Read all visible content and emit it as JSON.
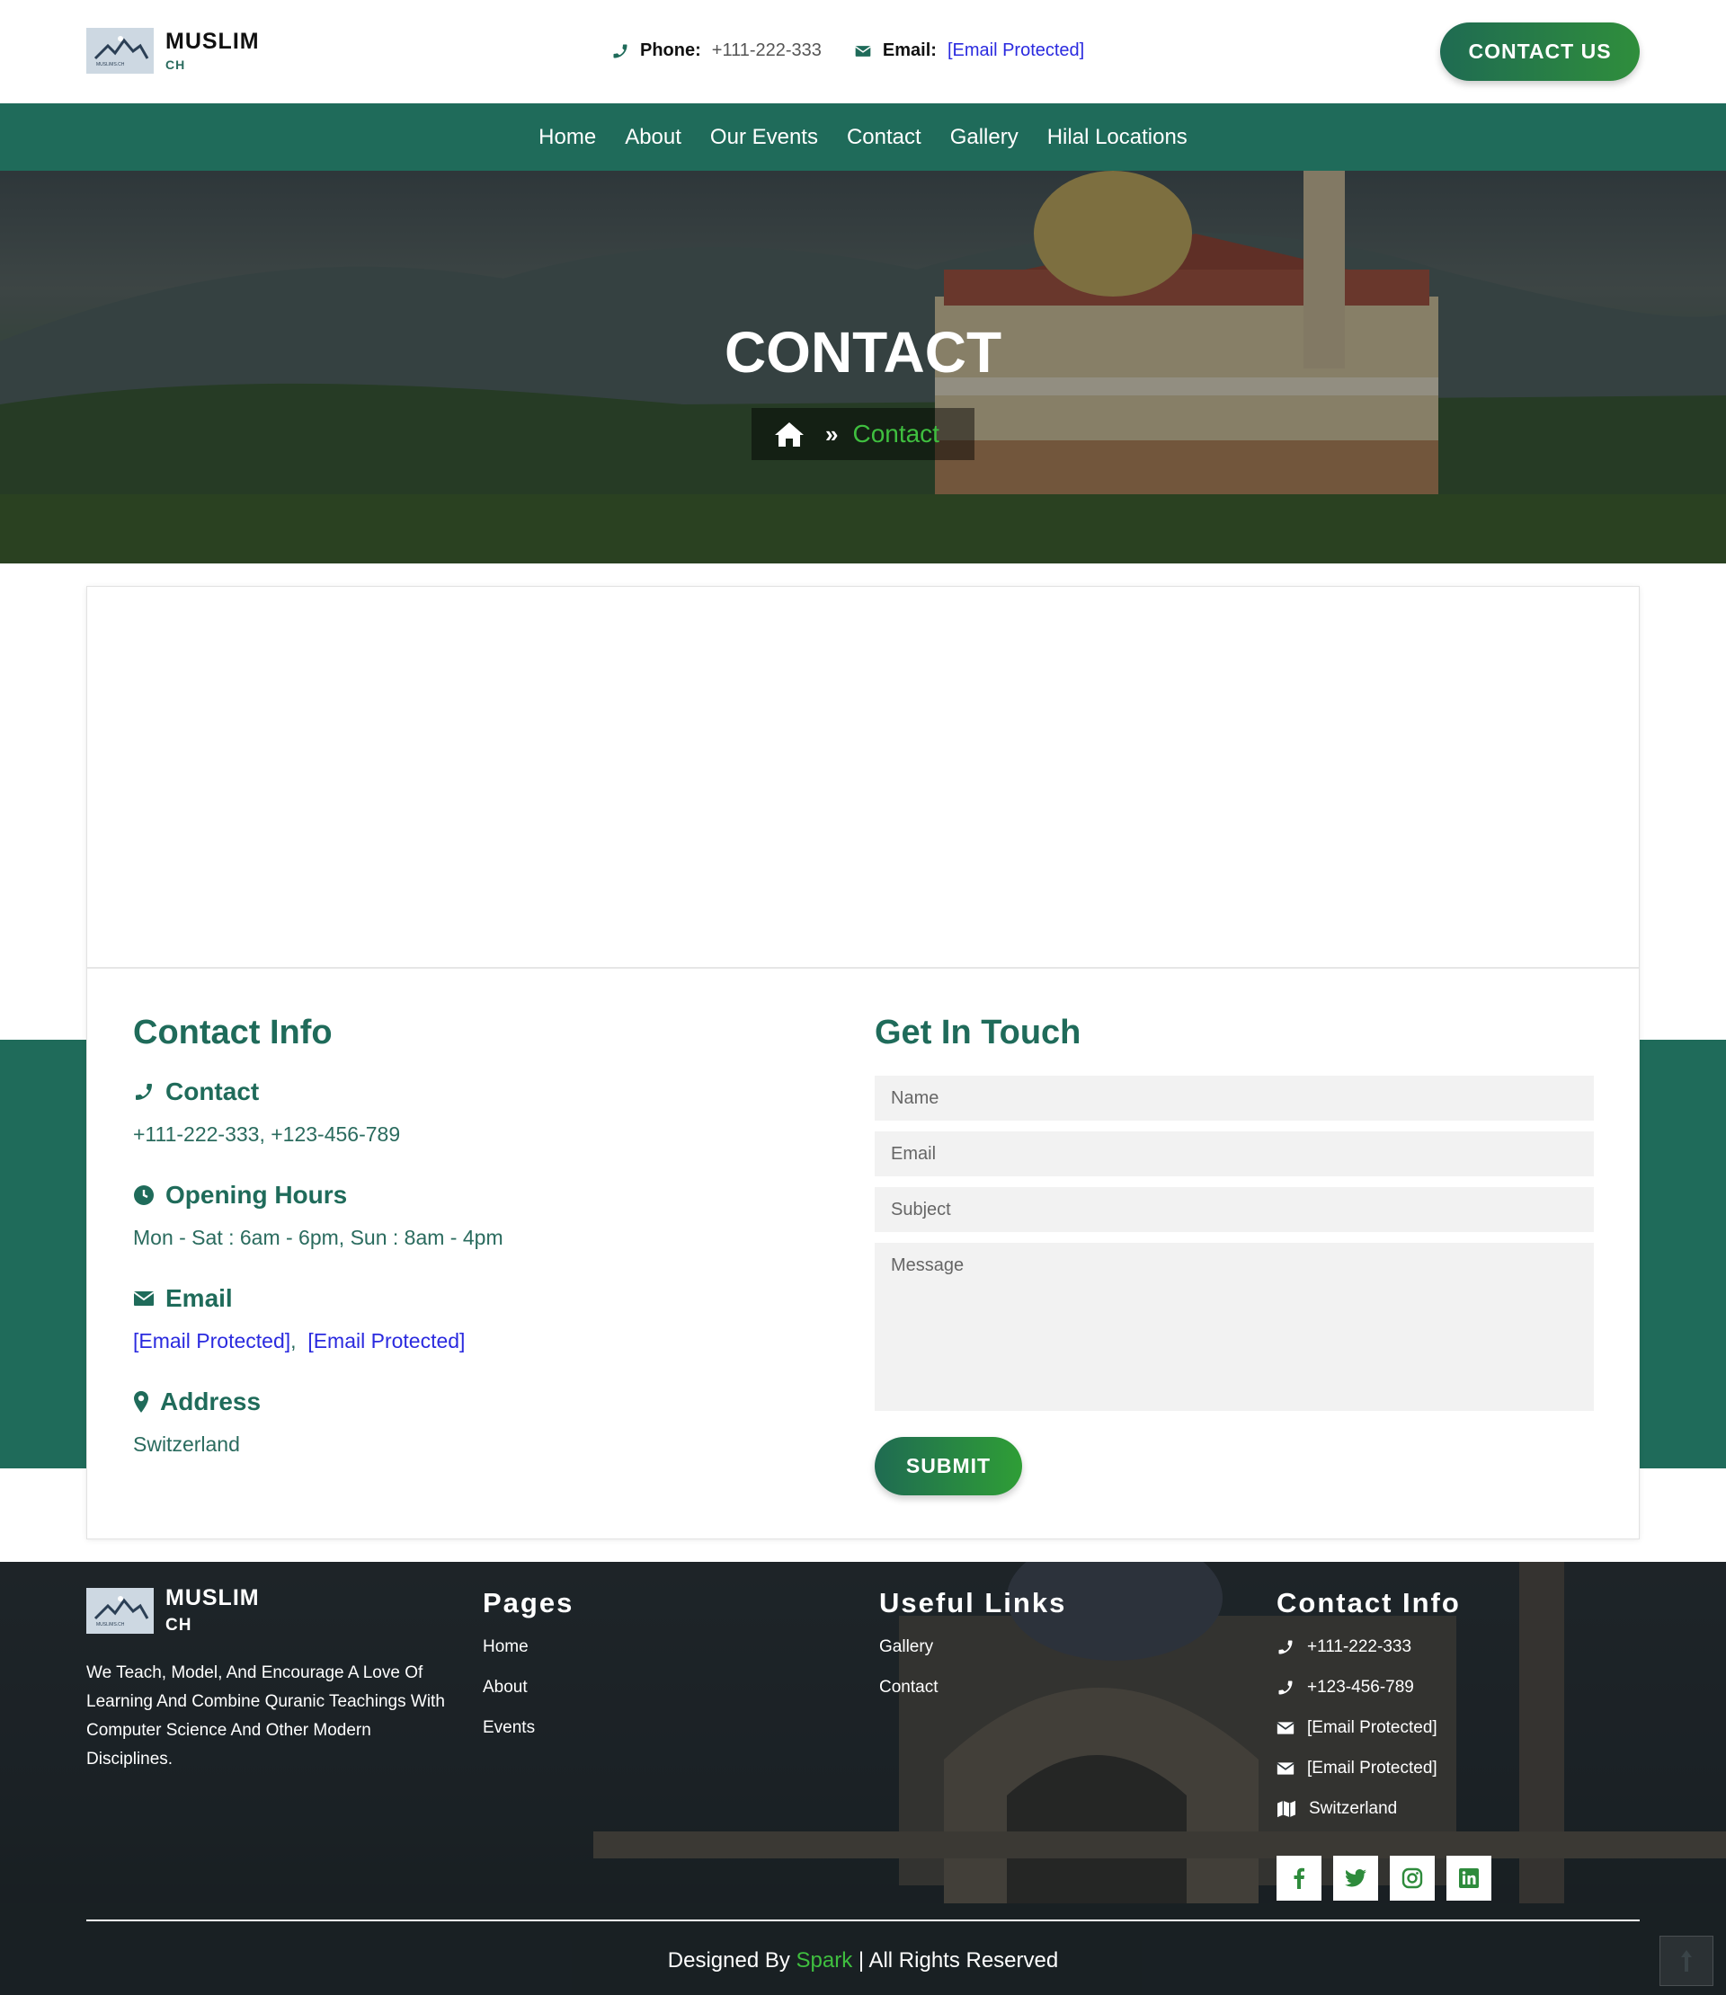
{
  "brand": {
    "name": "MUSLIM",
    "sub": "CH",
    "logo_caption": "MUSLIMS.CH"
  },
  "header": {
    "phone_label": "Phone:",
    "phone_value": "+111-222-333",
    "email_label": "Email:",
    "email_value": "[Email Protected]",
    "contact_button": "CONTACT US"
  },
  "nav": {
    "items": [
      "Home",
      "About",
      "Our Events",
      "Contact",
      "Gallery",
      "Hilal Locations"
    ]
  },
  "hero": {
    "title": "CONTACT",
    "breadcrumb_sep": "»",
    "breadcrumb_current": "Contact"
  },
  "contact_info": {
    "title": "Contact Info",
    "contact_head": "Contact",
    "contact_text": "+111-222-333,  +123-456-789",
    "hours_head": "Opening Hours",
    "hours_text": "Mon - Sat : 6am - 6pm,  Sun : 8am - 4pm",
    "email_head": "Email",
    "email_1": "[Email Protected]",
    "email_sep": ",  ",
    "email_2": "[Email Protected]",
    "address_head": "Address",
    "address_text": "Switzerland"
  },
  "form": {
    "title": "Get In Touch",
    "name_placeholder": "Name",
    "email_placeholder": "Email",
    "subject_placeholder": "Subject",
    "message_placeholder": "Message",
    "submit": "SUBMIT"
  },
  "footer": {
    "about": "We Teach, Model, And Encourage A Love Of Learning And Combine Quranic Teachings With Computer Science And Other Modern Disciplines.",
    "pages_title": "Pages",
    "pages": [
      "Home",
      "About",
      "Events"
    ],
    "links_title": "Useful Links",
    "links": [
      "Gallery",
      "Contact"
    ],
    "contact_title": "Contact Info",
    "phone_1": "+111-222-333",
    "phone_2": "+123-456-789",
    "email_1": "[Email Protected]",
    "email_2": "[Email Protected]",
    "location": "Switzerland",
    "copyright_prefix": "Designed By ",
    "copyright_brand": "Spark",
    "copyright_suffix": " | All Rights Reserved"
  },
  "colors": {
    "primary": "#1f6b5a",
    "accent": "#3fbf3f",
    "link": "#2a2adf"
  }
}
